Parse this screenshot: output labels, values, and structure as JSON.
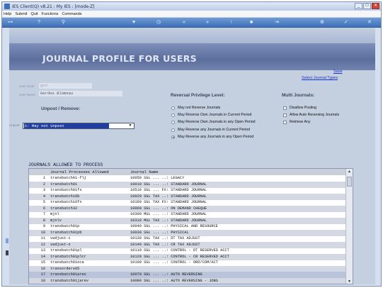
{
  "window": {
    "title": "IES Client(Q) v8.21 : My IES :     [mode-Z]",
    "buttons": [
      "_",
      "□",
      "✕"
    ]
  },
  "menubar": [
    "Help",
    "Submit",
    "Quit",
    "Functions",
    "Commands"
  ],
  "toolbar_icons": [
    "key-icon",
    "help-icon",
    "search-icon",
    "heart-icon",
    "clock-icon",
    "first-icon",
    "prev-icon",
    "next-icon",
    "last-icon",
    "stop-icon",
    "cross-icon",
    "add-icon",
    "check-icon",
    "close-icon"
  ],
  "header": {
    "title": "JOURNAL PROFILE FOR USERS"
  },
  "links": {
    "save": "Save",
    "select": "Select Journal Types"
  },
  "user": {
    "code_label": "User Code",
    "code_value": "ged",
    "name_label": "User Name",
    "name_value": "Gerdes Blomeau"
  },
  "unpost": {
    "heading": "Unpost / Remove:",
    "label": "Unpost",
    "value": "1: May not Unpost"
  },
  "reversal": {
    "heading": "Reversal Privilege Level:",
    "options": [
      {
        "label": "May not Reverse Journals",
        "selected": false
      },
      {
        "label": "May Reverse Own Journals in Current Period",
        "selected": false
      },
      {
        "label": "May Reverse Own Journals in any Open Period",
        "selected": false
      },
      {
        "label": "May Reverse any Journals in Current Period",
        "selected": false
      },
      {
        "label": "May Reverse any Journals in any Open Period",
        "selected": true
      }
    ]
  },
  "multi": {
    "heading": "Multi Journals:",
    "options": [
      {
        "label": "Disallow Posting"
      },
      {
        "label": "Allow Auto Reversing Journals"
      },
      {
        "label": "Retrieve Any"
      }
    ]
  },
  "table": {
    "title": "JOURNALS ALLOWED TO PROCESS",
    "columns": [
      "Journal Processes Allowed",
      "Journal Name"
    ],
    "rows": [
      {
        "n": "1",
        "name": "transbatch01-flj",
        "jn": "10050 SGL ... ..: LEGACY"
      },
      {
        "n": "2",
        "name": "transbatch01",
        "jn": "10010 SGL ... ..: STANDARD JOURNAL"
      },
      {
        "n": "3",
        "name": "transbatch01fx",
        "jn": "10510 SGL ... FX: STANDARD JOURNAL"
      },
      {
        "n": "4",
        "name": "transbatch16b",
        "jn": "10020 SGL TAX ..: STANDARD JOURNAL"
      },
      {
        "n": "5",
        "name": "transbatch16fx",
        "jn": "10160 SGL TAX FX: STANDARD JOURNAL"
      },
      {
        "n": "6",
        "name": "transbatch32",
        "jn": "10060 SGL ... ..: ON DEMAND CHEQUE"
      },
      {
        "n": "7",
        "name": "mjnl",
        "jn": "10300 MUL ... ..: STANDARD JOURNAL"
      },
      {
        "n": "8",
        "name": "mjnlv",
        "jn": "10310 MUL TAX ..: STANDARD JOURNAL"
      },
      {
        "n": "9",
        "name": "transbatch01p",
        "jn": "10040 SGL ... ..: PHYSICAL AND RESOURCE"
      },
      {
        "n": "10",
        "name": "transbatch01pb",
        "jn": "10030 SGL ... ..: PHYSICAL"
      },
      {
        "n": "11",
        "name": "vadjust-i",
        "jn": "10130 SGL TAX ..: DT TAX ADJUST"
      },
      {
        "n": "12",
        "name": "vadjust-o",
        "jn": "10140 SGL TAX ..: CR TAX ADJUST"
      },
      {
        "n": "13",
        "name": "transbatch01pl",
        "jn": "10110 SGL ... ..: CONTROL - DT RESERVED ACCT"
      },
      {
        "n": "14",
        "name": "transbatch01plcr",
        "jn": "10120 SGL ... ..: CONTROL - CR RESERVED ACCT"
      },
      {
        "n": "15",
        "name": "transbatch01oca",
        "jn": "10100 SGL ... ..: CONTROL - ORD/COM/ACT"
      },
      {
        "n": "16",
        "name": "transorders05",
        "jn": ""
      },
      {
        "n": "17",
        "name": "transbatch01arev",
        "jn": "10070 SGL ... ..: AUTO REVERSING"
      },
      {
        "n": "18",
        "name": "transbatch01jarev",
        "jn": "10080 SGL ... ..: AUTO REVERSING - JOBS"
      }
    ]
  }
}
